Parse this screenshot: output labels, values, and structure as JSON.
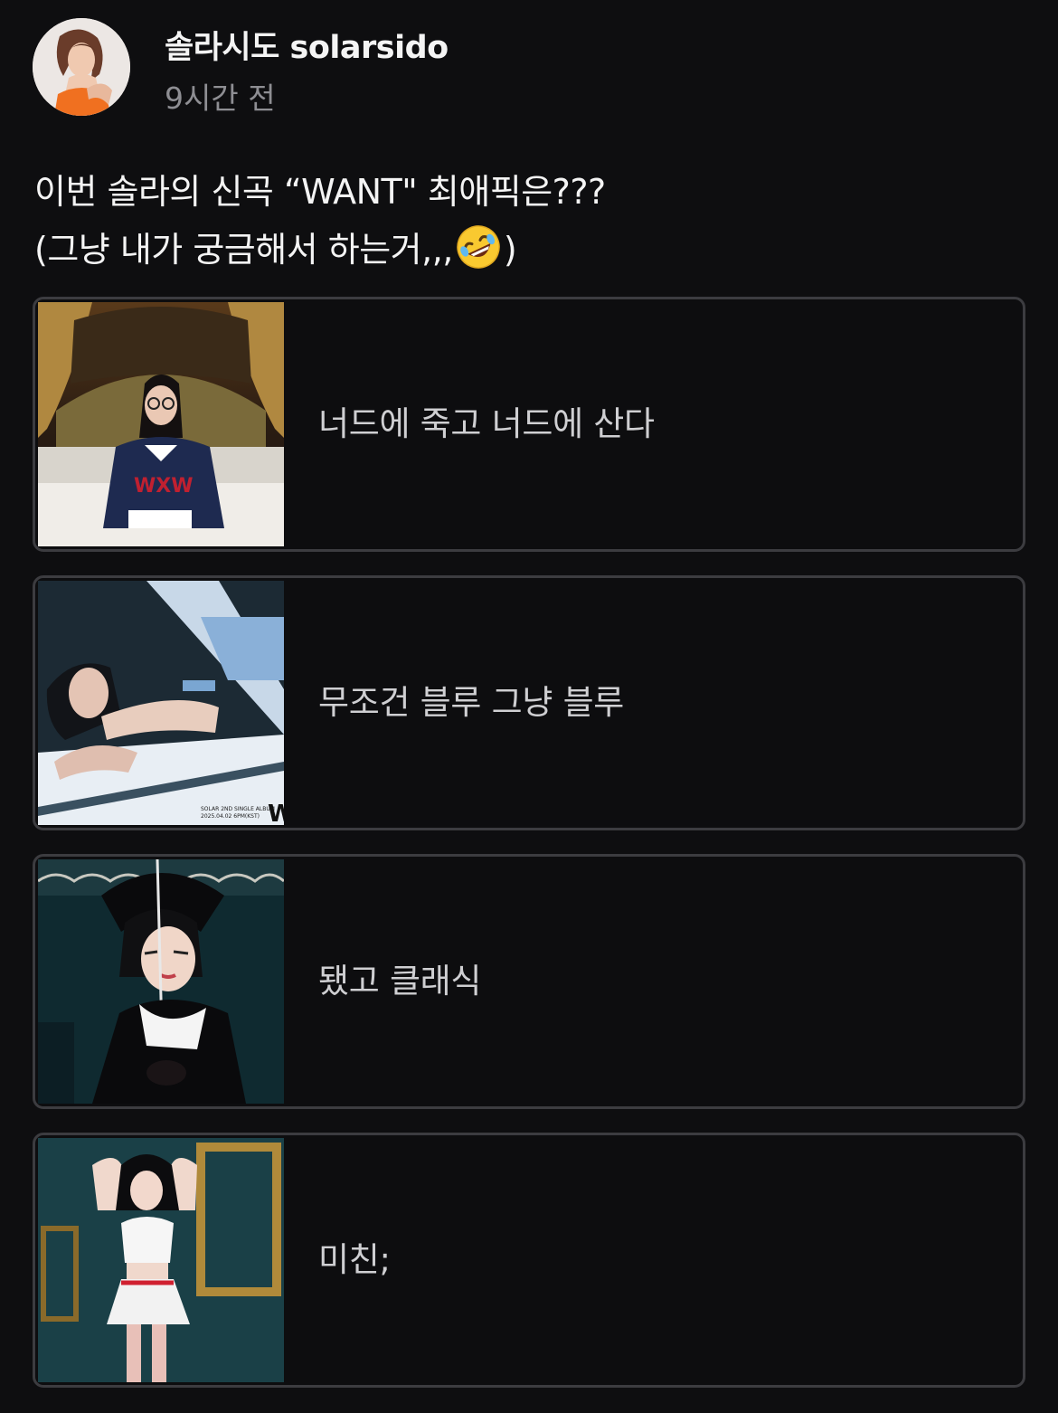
{
  "author": {
    "name": "솔라시도 solarsido",
    "time": "9시간 전",
    "avatar_icon": "profile-photo"
  },
  "post": {
    "line1": "이번 솔라의 신곡 “WANT\"  최애픽은???",
    "line2_before": "(그냥 내가 궁금해서 하는거,,,",
    "line2_emoji": "rolling-on-floor-laughing-emoji",
    "line2_after": ")"
  },
  "poll": {
    "options": [
      {
        "label": "너드에 죽고 너드에 산다",
        "thumb": "nerd-concept-photo"
      },
      {
        "label": "무조건 블루 그냥 블루",
        "thumb": "blue-concept-photo",
        "thumb_caption": "SOLAR 2ND SINGLE ALBUM\n2025.04.02 6PM(KST)",
        "thumb_mark": "W"
      },
      {
        "label": "됐고 클래식",
        "thumb": "classic-concept-photo"
      },
      {
        "label": "미친;",
        "thumb": "crazy-concept-photo"
      }
    ]
  },
  "colors": {
    "background": "#0e0e10",
    "option_border": "#3c3c40",
    "muted_text": "#8e8e93"
  }
}
